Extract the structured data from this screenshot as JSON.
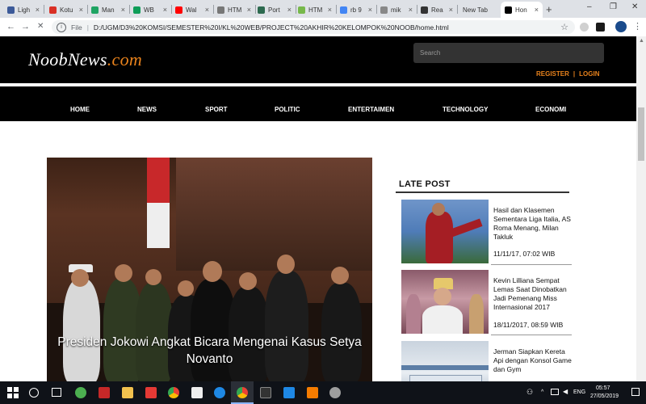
{
  "browser": {
    "tabs": [
      {
        "label": "Ligh",
        "color": "#3c5a99"
      },
      {
        "label": "Kotu",
        "color": "#d93025"
      },
      {
        "label": "Man",
        "color": "#1fa463"
      },
      {
        "label": "WB",
        "color": "#0f9d58"
      },
      {
        "label": "Wal",
        "color": "#ff0000"
      },
      {
        "label": "HTM",
        "color": "#777777"
      },
      {
        "label": "Port",
        "color": "#2d6a4f"
      },
      {
        "label": "HTM",
        "color": "#77b84a"
      },
      {
        "label": "rb 9",
        "color": "#4285f4"
      },
      {
        "label": "mik",
        "color": "#888888"
      },
      {
        "label": "Rea",
        "color": "#333333"
      },
      {
        "label": "New Tab",
        "color": ""
      },
      {
        "label": "Hon",
        "color": "#000000"
      }
    ],
    "new_tab_glyph": "+",
    "window_controls": [
      "–",
      "❐",
      "✕"
    ],
    "url_scheme_label": "File",
    "url": "D:/UGM/D3%20KOMSI/SEMESTER%20I/KL%20WEB/PROJECT%20AKHIR%20KELOMPOK%20NOOB/home.html"
  },
  "site": {
    "logo_main": "NoobNews",
    "logo_domain": ".com",
    "search_placeholder": "Search",
    "register_label": "REGISTER",
    "auth_separator": "|",
    "login_label": "LOGIN",
    "nav": [
      "HOME",
      "NEWS",
      "SPORT",
      "POLITIC",
      "ENTERTAIMEN",
      "TECHNOLOGY",
      "ECONOMI"
    ],
    "hero_caption": "Presiden Jokowi Angkat Bicara Mengenai Kasus Setya Novanto",
    "late_post_title": "LATE POST",
    "posts": [
      {
        "title": "Hasil dan Klasemen Sementara Liga Italia, AS Roma Menang, Milan Takluk",
        "date": "11/11/17, 07:02 WIB"
      },
      {
        "title": "Kevin Lilliana Sempat Lemas Saat Dinobatkan Jadi Pemenang Miss Internasional 2017",
        "date": "18/11/2017, 08:59 WIB"
      },
      {
        "title": "Jerman Siapkan Kereta Api dengan Konsol Game dan Gym",
        "date": ""
      }
    ]
  },
  "taskbar": {
    "language": "ENG",
    "time": "05:57",
    "date": "27/05/2019"
  }
}
